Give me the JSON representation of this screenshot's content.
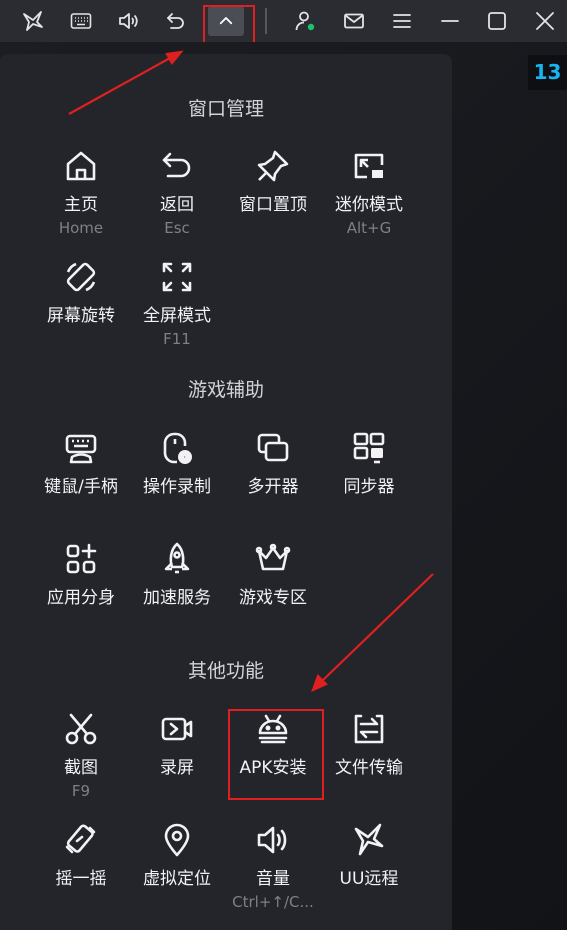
{
  "toolbar": {
    "icons": [
      "butterfly-icon",
      "keyboard-icon",
      "volume-icon",
      "back-icon",
      "collapse-icon",
      "user-status-icon",
      "mail-icon",
      "menu-icon",
      "minimize-icon",
      "maximize-icon",
      "close-icon"
    ],
    "accent": "#19c36a"
  },
  "side_badge": "13",
  "sections": {
    "window": "窗口管理",
    "game": "游戏辅助",
    "other": "其他功能"
  },
  "items": {
    "home": {
      "label": "主页",
      "shortcut": "Home"
    },
    "back": {
      "label": "返回",
      "shortcut": "Esc"
    },
    "pin": {
      "label": "窗口置顶"
    },
    "mini": {
      "label": "迷你模式",
      "shortcut": "Alt+G"
    },
    "rotate": {
      "label": "屏幕旋转"
    },
    "fullscreen": {
      "label": "全屏模式",
      "shortcut": "F11"
    },
    "keymap": {
      "label": "键鼠/手柄"
    },
    "record_ops": {
      "label": "操作录制"
    },
    "multi": {
      "label": "多开器"
    },
    "sync": {
      "label": "同步器"
    },
    "clone": {
      "label": "应用分身"
    },
    "boost": {
      "label": "加速服务"
    },
    "gamezone": {
      "label": "游戏专区"
    },
    "screenshot": {
      "label": "截图",
      "shortcut": "F9"
    },
    "screenrec": {
      "label": "录屏"
    },
    "apk": {
      "label": "APK安装"
    },
    "transfer": {
      "label": "文件传输"
    },
    "shake": {
      "label": "摇一摇"
    },
    "location": {
      "label": "虚拟定位"
    },
    "volume": {
      "label": "音量",
      "shortcut": "Ctrl+↑/C..."
    },
    "uu": {
      "label": "UU远程"
    }
  },
  "colors": {
    "panel": "#23252b",
    "annotation": "#e02020",
    "badge": "#18b4f0"
  }
}
